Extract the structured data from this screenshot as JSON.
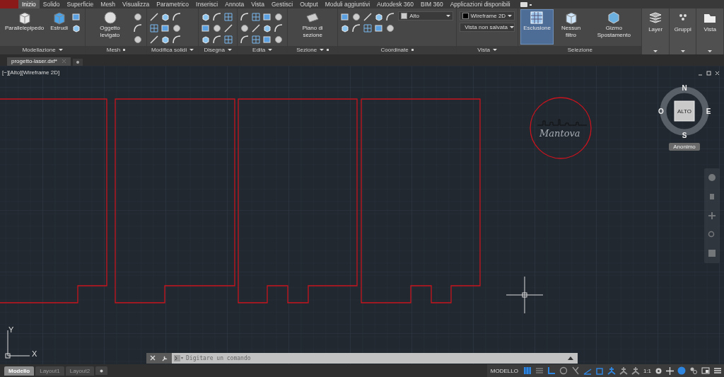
{
  "ribbon_tabs": [
    {
      "label": "Inizio",
      "selected": true
    },
    {
      "label": "Solido",
      "selected": false
    },
    {
      "label": "Superficie",
      "selected": false
    },
    {
      "label": "Mesh",
      "selected": false
    },
    {
      "label": "Visualizza",
      "selected": false
    },
    {
      "label": "Parametrico",
      "selected": false
    },
    {
      "label": "Inserisci",
      "selected": false
    },
    {
      "label": "Annota",
      "selected": false
    },
    {
      "label": "Vista",
      "selected": false
    },
    {
      "label": "Gestisci",
      "selected": false
    },
    {
      "label": "Output",
      "selected": false
    },
    {
      "label": "Moduli aggiuntivi",
      "selected": false
    },
    {
      "label": "Autodesk 360",
      "selected": false
    },
    {
      "label": "BIM 360",
      "selected": false
    },
    {
      "label": "Applicazioni disponibili",
      "selected": false
    }
  ],
  "panels": [
    {
      "title": "Modellazione",
      "menu": true,
      "launcher": false,
      "buttons": [
        {
          "label": "Parallelepipedo"
        },
        {
          "label": "Estrudi"
        }
      ]
    },
    {
      "title": "Mesh",
      "menu": false,
      "launcher": true,
      "buttons": [
        {
          "label": "Oggetto levigato"
        }
      ]
    },
    {
      "title": "Modifica solidi",
      "menu": true,
      "launcher": false
    },
    {
      "title": "Disegna",
      "menu": true,
      "launcher": false
    },
    {
      "title": "Edita",
      "menu": true,
      "launcher": false
    },
    {
      "title": "Sezione",
      "menu": true,
      "launcher": true,
      "buttons": [
        {
          "label": "Piano di sezione"
        }
      ]
    },
    {
      "title": "Coordinate",
      "menu": false,
      "launcher": true,
      "dropdowns": [
        "Alto"
      ]
    },
    {
      "title": "Vista",
      "menu": true,
      "launcher": false,
      "dropdowns": [
        "Wireframe 2D",
        "Vista non salvata"
      ]
    },
    {
      "title": "Selezione",
      "menu": false,
      "launcher": false,
      "buttons": [
        {
          "label": "Esclusione",
          "selected": true
        },
        {
          "label": "Nessun filtro",
          "selected": false
        },
        {
          "label": "Gizmo Spostamento",
          "selected": false
        }
      ]
    }
  ],
  "collapsed_panels": [
    {
      "label": "Layer"
    },
    {
      "label": "Gruppi"
    },
    {
      "label": "Vista"
    }
  ],
  "file_tabs": [
    {
      "label": "progetto-laser.dxf*",
      "selected": true
    }
  ],
  "viewport": {
    "label": "[−][Alto][Wireframe 2D]"
  },
  "drawing": {
    "text": "Mantova"
  },
  "view_cube": {
    "north": "N",
    "south": "S",
    "east": "E",
    "west": "O",
    "face": "ALTO",
    "ucs": "Anonimo"
  },
  "ucs_icon": {
    "x": "X",
    "y": "Y"
  },
  "command_line": {
    "placeholder": "Digitare un comando"
  },
  "layout_tabs": [
    {
      "label": "Modello",
      "selected": true
    },
    {
      "label": "Layout1",
      "selected": false
    },
    {
      "label": "Layout2",
      "selected": false
    }
  ],
  "status_bar": {
    "space": "MODELLO",
    "scale": "1:1",
    "toggles": [
      {
        "kind": "grid",
        "on": true
      },
      {
        "kind": "snap",
        "on": false
      },
      {
        "kind": "ortho",
        "on": true
      },
      {
        "kind": "polar",
        "on": false
      },
      {
        "kind": "iso",
        "on": false
      },
      {
        "kind": "dynucs",
        "on": true
      },
      {
        "kind": "track",
        "on": true
      },
      {
        "kind": "annot",
        "on": true
      },
      {
        "kind": "annot",
        "on": false
      },
      {
        "kind": "annot",
        "on": false
      }
    ]
  }
}
